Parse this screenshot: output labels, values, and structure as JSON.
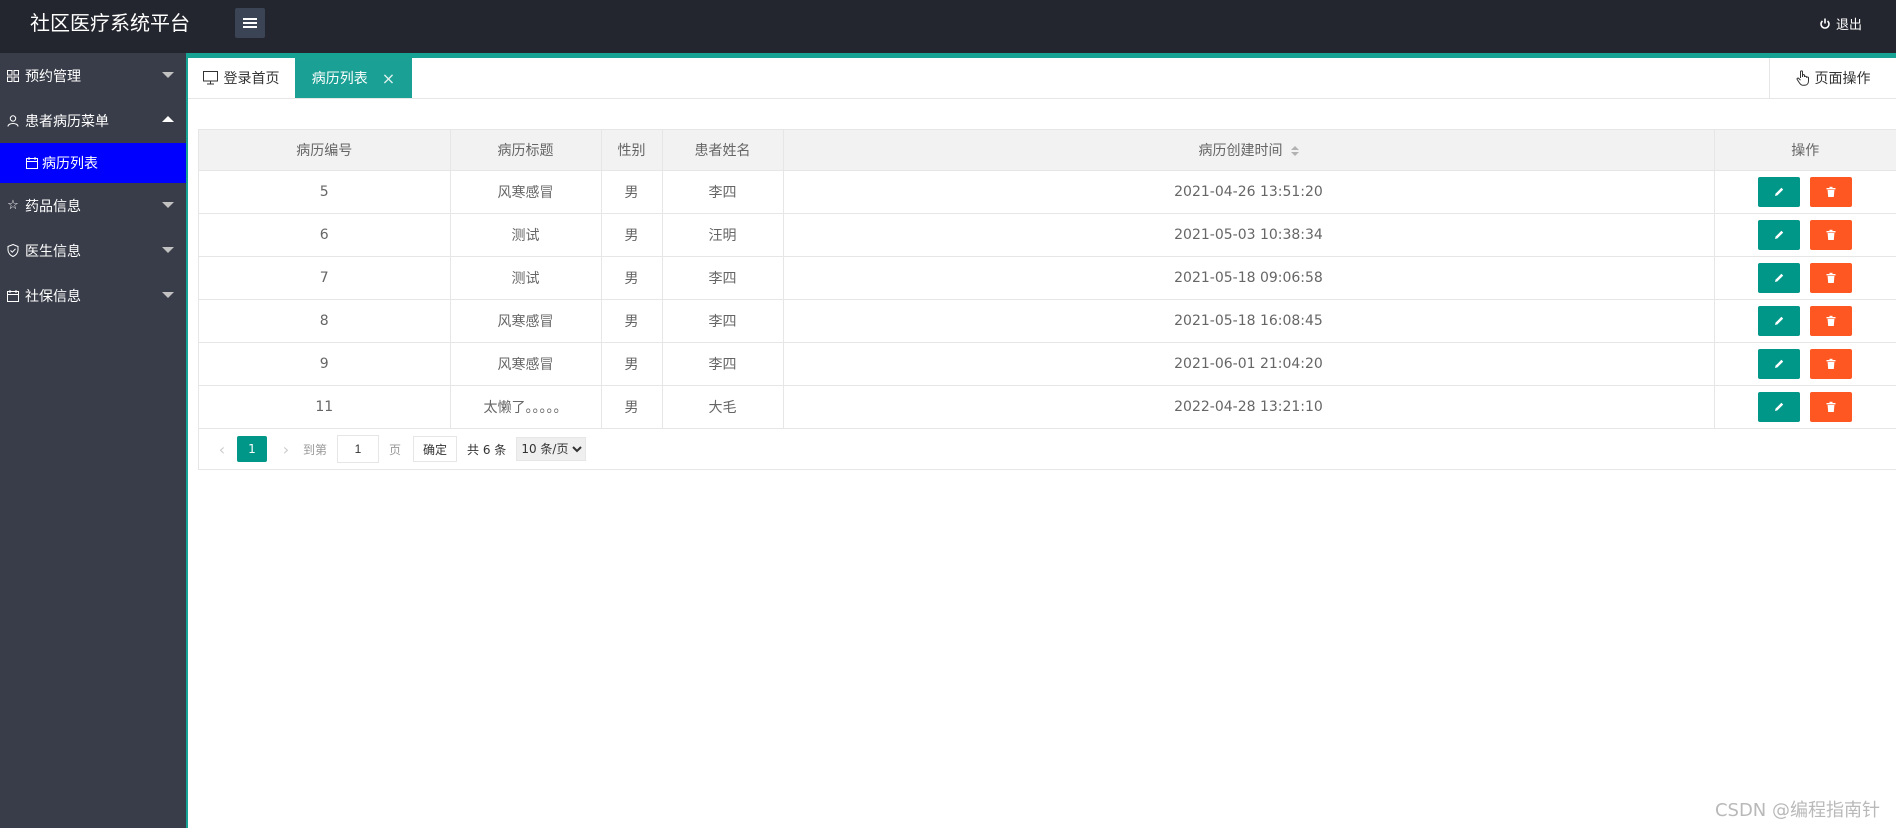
{
  "app": {
    "title": "社区医疗系统平台",
    "logout_label": "退出"
  },
  "sidebar": {
    "items": [
      {
        "label": "预约管理",
        "icon": "grid-icon",
        "expanded": false
      },
      {
        "label": "患者病历菜单",
        "icon": "user-icon",
        "expanded": true,
        "children": [
          {
            "label": "病历列表",
            "icon": "calendar-icon",
            "active": true
          }
        ]
      },
      {
        "label": "药品信息",
        "icon": "star-icon",
        "expanded": false
      },
      {
        "label": "医生信息",
        "icon": "shield-icon",
        "expanded": false
      },
      {
        "label": "社保信息",
        "icon": "calendar-icon",
        "expanded": false
      }
    ]
  },
  "tabs": {
    "home_label": "登录首页",
    "active_label": "病历列表",
    "page_ops_label": "页面操作"
  },
  "table": {
    "columns": [
      "病历编号",
      "病历标题",
      "性别",
      "患者姓名",
      "病历创建时间",
      "操作"
    ],
    "rows": [
      {
        "id": "5",
        "title": "风寒感冒",
        "gender": "男",
        "name": "李四",
        "created": "2021-04-26 13:51:20"
      },
      {
        "id": "6",
        "title": "测试",
        "gender": "男",
        "name": "汪明",
        "created": "2021-05-03 10:38:34"
      },
      {
        "id": "7",
        "title": "测试",
        "gender": "男",
        "name": "李四",
        "created": "2021-05-18 09:06:58"
      },
      {
        "id": "8",
        "title": "风寒感冒",
        "gender": "男",
        "name": "李四",
        "created": "2021-05-18 16:08:45"
      },
      {
        "id": "9",
        "title": "风寒感冒",
        "gender": "男",
        "name": "李四",
        "created": "2021-06-01 21:04:20"
      },
      {
        "id": "11",
        "title": "太懒了。。。。。",
        "gender": "男",
        "name": "大毛",
        "created": "2022-04-28 13:21:10"
      }
    ]
  },
  "pager": {
    "current_page": "1",
    "goto_label": "到第",
    "page_input": "1",
    "page_unit": "页",
    "confirm_label": "确定",
    "total_label": "共 6 条",
    "page_size_selected": "10 条/页"
  },
  "watermark": "CSDN @编程指南针",
  "colors": {
    "accent": "#16a394",
    "edit": "#009688",
    "delete": "#ff5722",
    "active_nav": "#0000ff",
    "sidebar": "#393d49",
    "topbar": "#23262e"
  }
}
